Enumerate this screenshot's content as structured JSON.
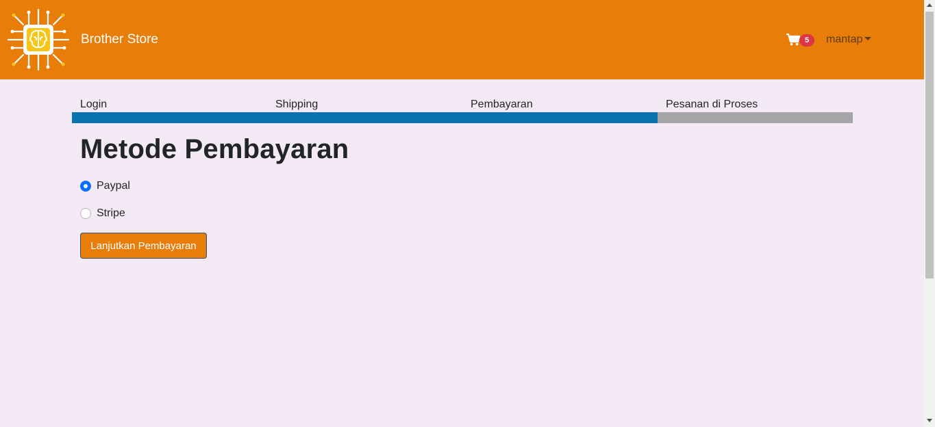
{
  "navbar": {
    "brand": "Brother Store",
    "logo_icon": "circuit-brain-icon",
    "cart_icon": "cart-icon",
    "cart_count": "5",
    "user_name": "mantap",
    "background": "#e97d0a"
  },
  "steps": {
    "items": [
      "Login",
      "Shipping",
      "Pembayaran",
      "Pesanan di Proses"
    ],
    "progress_percent": 75,
    "fill_color": "#0a75ad",
    "track_color": "#a5a4a6"
  },
  "main": {
    "title": "Metode Pembayaran",
    "options": [
      {
        "label": "Paypal",
        "checked": true
      },
      {
        "label": "Stripe",
        "checked": false
      }
    ],
    "continue_label": "Lanjutkan Pembayaran"
  }
}
